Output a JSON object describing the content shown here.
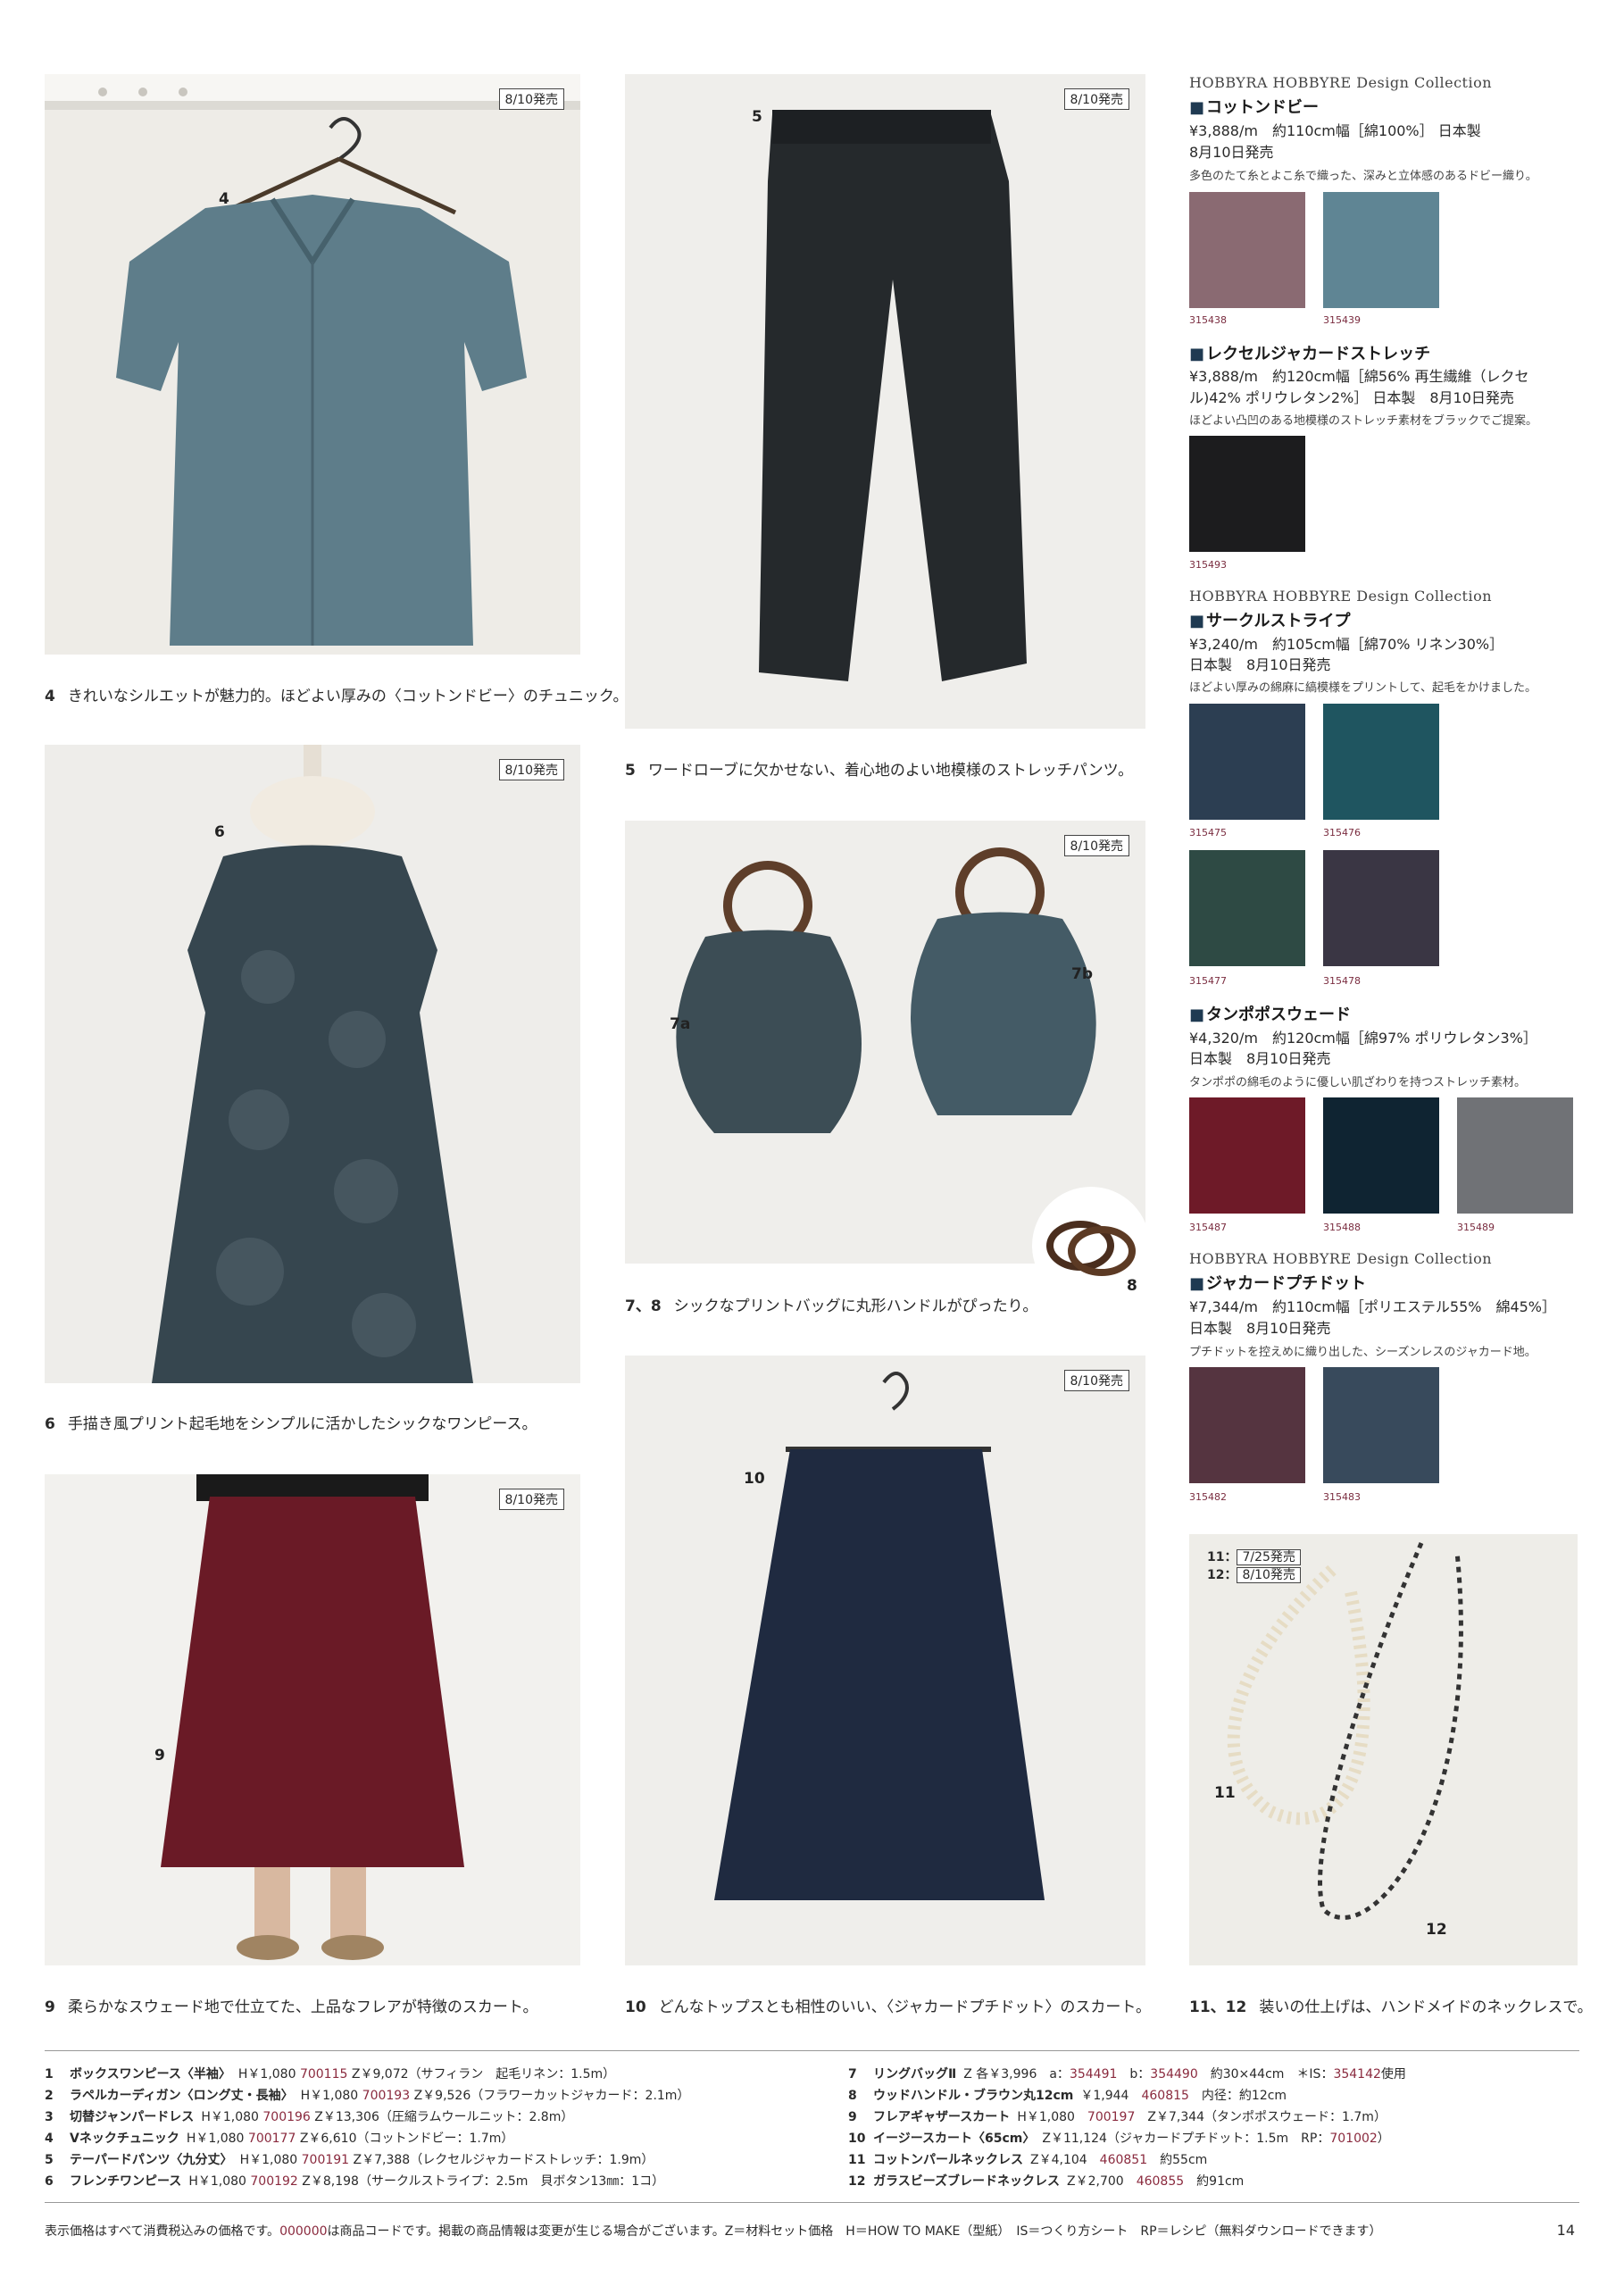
{
  "badges": {
    "p4": "8/10発売",
    "p5": "8/10発売",
    "p6": "8/10発売",
    "p7": "8/10発売",
    "p9": "8/10発売",
    "p10": "8/10発売"
  },
  "photo_labels": {
    "p4": "4",
    "p5": "5",
    "p6": "6",
    "p7a": "7a",
    "p7b": "7b",
    "p8": "8",
    "p9": "9",
    "p10": "10",
    "p11": "11",
    "p12": "12",
    "p11_tag": "11：",
    "p11_date": "7/25発売",
    "p12_tag": "12：",
    "p12_date": "8/10発売"
  },
  "captions": [
    {
      "num": "4",
      "text": "きれいなシルエットが魅力的。ほどよい厚みの〈コットンドビー〉のチュニック。"
    },
    {
      "num": "5",
      "text": "ワードローブに欠かせない、着心地のよい地模様のストレッチパンツ。"
    },
    {
      "num": "6",
      "text": "手描き風プリント起毛地をシンプルに活かしたシックなワンピース。"
    },
    {
      "num": "7、8",
      "text": "シックなプリントバッグに丸形ハンドルがぴったり。"
    },
    {
      "num": "9",
      "text": "柔らかなスウェード地で仕立てた、上品なフレアが特徴のスカート。"
    },
    {
      "num": "10",
      "text": "どんなトップスとも相性のいい、〈ジャカードプチドット〉のスカート。"
    },
    {
      "num": "11、12",
      "text": "装いの仕上げは、ハンドメイドのネックレスで。"
    }
  ],
  "fabrics": [
    {
      "brand": "HOBBYRA HOBBYRE  Design Collection",
      "name": "コットンドビー",
      "lines": [
        "¥3,888/m　約110cm幅［綿100%］ 日本製",
        "8月10日発売"
      ],
      "desc": "多色のたて糸とよこ糸で織った、深みと立体感のあるドビー織り。",
      "swatches": [
        {
          "code": "315438",
          "color": "#8a6a72"
        },
        {
          "code": "315439",
          "color": "#5f8594"
        }
      ]
    },
    {
      "brand": "",
      "name": "レクセルジャカードストレッチ",
      "lines": [
        "¥3,888/m　約120cm幅［綿56% 再生繊維（レクセ",
        "ル)42% ポリウレタン2%］ 日本製　8月10日発売"
      ],
      "desc": "ほどよい凸凹のある地模様のストレッチ素材をブラックでご提案。",
      "swatches": [
        {
          "code": "315493",
          "color": "#1c1c1e"
        }
      ]
    },
    {
      "brand": "HOBBYRA HOBBYRE  Design Collection",
      "name": "サークルストライプ",
      "lines": [
        "¥3,240/m　約105cm幅［綿70% リネン30%］",
        "日本製　8月10日発売"
      ],
      "desc": "ほどよい厚みの綿麻に縞模様をプリントして、起毛をかけました。",
      "swatches": [
        {
          "code": "315475",
          "color": "#2c3e52"
        },
        {
          "code": "315476",
          "color": "#1f5560"
        },
        {
          "code": "315477",
          "color": "#2e4a44"
        },
        {
          "code": "315478",
          "color": "#3a3644"
        }
      ]
    },
    {
      "brand": "",
      "name": "タンポポスウェード",
      "lines": [
        "¥4,320/m　約120cm幅［綿97% ポリウレタン3%］",
        "日本製　8月10日発売"
      ],
      "desc": "タンポポの綿毛のように優しい肌ざわりを持つストレッチ素材。",
      "swatches": [
        {
          "code": "315487",
          "color": "#6e1a28"
        },
        {
          "code": "315488",
          "color": "#0f2432"
        },
        {
          "code": "315489",
          "color": "#707276"
        }
      ]
    },
    {
      "brand": "HOBBYRA HOBBYRE  Design Collection",
      "name": "ジャカードプチドット",
      "lines": [
        "¥7,344/m　約110cm幅［ポリエステル55%　綿45%］",
        "日本製　8月10日発売"
      ],
      "desc": "プチドットを控えめに織り出した、シーズンレスのジャカード地。",
      "swatches": [
        {
          "code": "315482",
          "color": "#553440"
        },
        {
          "code": "315483",
          "color": "#384a5c"
        }
      ]
    }
  ],
  "products_left": [
    {
      "n": "1",
      "name": "ボックスワンピース〈半袖〉",
      "h": "H￥1,080",
      "hcode": "700115",
      "z": "Z￥9,072（サフィラン　起毛リネン：1.5m）"
    },
    {
      "n": "2",
      "name": "ラペルカーディガン〈ロング丈・長袖〉",
      "h": "H￥1,080",
      "hcode": "700193",
      "z": "Z￥9,526（フラワーカットジャカード：2.1m）"
    },
    {
      "n": "3",
      "name": "切替ジャンパードレス",
      "h": "H￥1,080",
      "hcode": "700196",
      "z": "Z￥13,306（圧縮ラムウールニット：2.8m）"
    },
    {
      "n": "4",
      "name": "Vネックチュニック",
      "h": "H￥1,080",
      "hcode": "700177",
      "z": "Z￥6,610（コットンドビー：1.7m）"
    },
    {
      "n": "5",
      "name": "テーパードパンツ〈九分丈〉",
      "h": "H￥1,080",
      "hcode": "700191",
      "z": "Z￥7,388（レクセルジャカードストレッチ：1.9m）"
    },
    {
      "n": "6",
      "name": "フレンチワンピース",
      "h": "H￥1,080",
      "hcode": "700192",
      "z": "Z￥8,198（サークルストライプ：2.5m　貝ボタン13㎜：1コ）"
    }
  ],
  "products_right": [
    {
      "n": "7",
      "name": "リングバッグⅡ",
      "pre": "Z 各￥3,996　a：",
      "c1": "354491",
      "mid": "　b：",
      "c2": "354490",
      "post": "　約30×44cm　＊IS：",
      "c3": "354142",
      "tail": "使用"
    },
    {
      "n": "8",
      "name": "ウッドハンドル・ブラウン丸12cm",
      "pre": "￥1,944　",
      "c1": "460815",
      "mid": "　内径：約12cm",
      "c2": "",
      "post": "",
      "c3": "",
      "tail": ""
    },
    {
      "n": "9",
      "name": "フレアギャザースカート",
      "pre": "H￥1,080　",
      "c1": "700197",
      "mid": "　Z￥7,344（タンポポスウェード：1.7m）",
      "c2": "",
      "post": "",
      "c3": "",
      "tail": ""
    },
    {
      "n": "10",
      "name": "イージースカート〈65cm〉",
      "pre": "Z￥11,124（ジャカードプチドット：1.5m　RP：",
      "c1": "701002",
      "mid": "）",
      "c2": "",
      "post": "",
      "c3": "",
      "tail": ""
    },
    {
      "n": "11",
      "name": "コットンパールネックレス",
      "pre": "Z￥4,104　",
      "c1": "460851",
      "mid": "　約55cm",
      "c2": "",
      "post": "",
      "c3": "",
      "tail": ""
    },
    {
      "n": "12",
      "name": "ガラスビーズブレードネックレス",
      "pre": "Z￥2,700　",
      "c1": "460855",
      "mid": "　約91cm",
      "c2": "",
      "post": "",
      "c3": "",
      "tail": ""
    }
  ],
  "footer": {
    "a": "表示価格はすべて消費税込みの価格です。",
    "code": "000000",
    "b": "は商品コードです。掲載の商品情報は変更が生じる場合がございます。Z＝材料セット価格　H＝HOW TO MAKE（型紙）　IS＝つくり方シート　RP＝レシピ（無料ダウンロードできます）",
    "page": "14"
  }
}
